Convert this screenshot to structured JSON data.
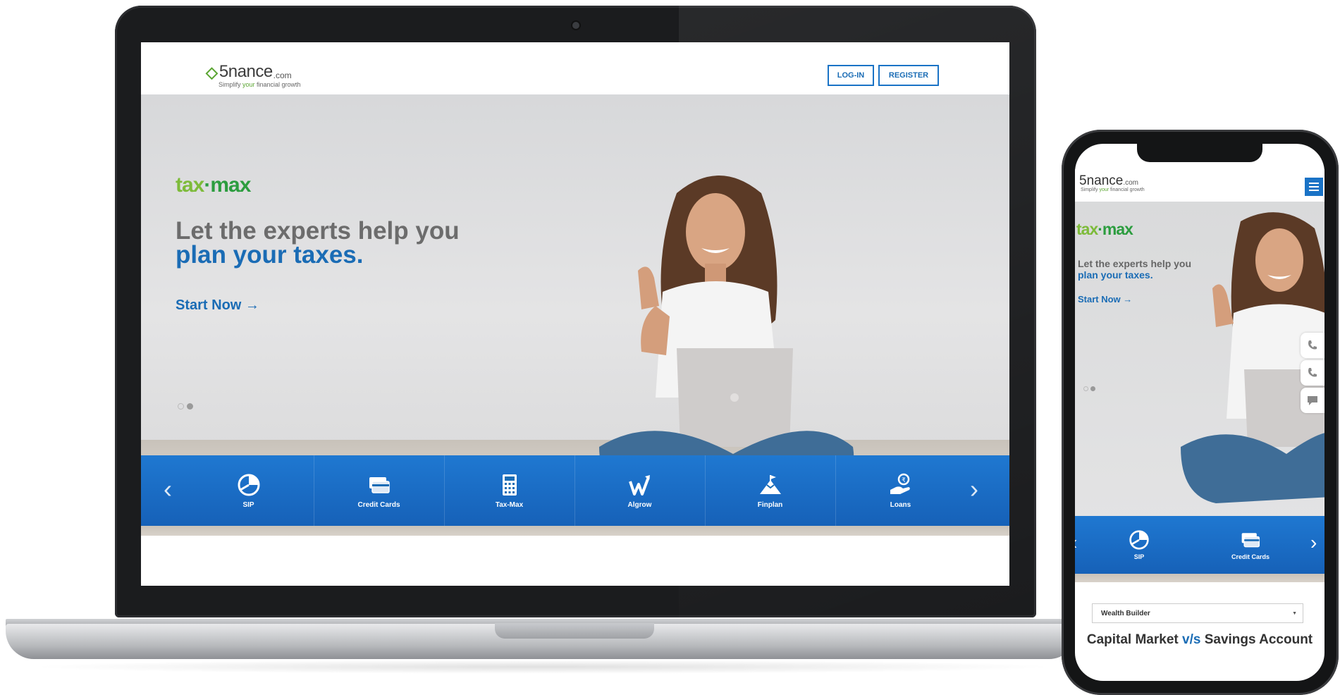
{
  "site": {
    "logo": {
      "mark": "◇",
      "name": "5nance",
      "domain": ".com"
    },
    "tagline_parts": [
      "Simplify ",
      "your",
      " financial growth"
    ]
  },
  "header": {
    "login_label": "LOG-IN",
    "register_label": "REGISTER"
  },
  "hero": {
    "brand_a": "tax",
    "brand_b": "max",
    "headline_line1": "Let the experts help you",
    "headline_line2": "plan your taxes.",
    "cta_label": "Start Now →",
    "slide_count": 2,
    "active_slide": 2
  },
  "products": [
    {
      "label": "SIP",
      "icon": "pie-chart-icon"
    },
    {
      "label": "Credit Cards",
      "icon": "credit-card-icon"
    },
    {
      "label": "Tax-Max",
      "icon": "calculator-icon"
    },
    {
      "label": "Algrow",
      "icon": "growth-arrow-icon"
    },
    {
      "label": "Finplan",
      "icon": "mountain-flag-icon"
    },
    {
      "label": "Loans",
      "icon": "hand-coin-icon"
    }
  ],
  "nav_arrows": {
    "prev": "‹",
    "next": "›"
  },
  "mobile": {
    "logo": {
      "name": "5nance",
      "domain": ".com"
    },
    "tagline_parts": [
      "Simplify ",
      "your",
      " financial growth"
    ],
    "hero": {
      "brand_a": "tax",
      "brand_b": "max",
      "headline_line1": "Let the experts help you",
      "headline_line2": "plan your taxes.",
      "cta_label": "Start Now →"
    },
    "products": [
      {
        "label": "SIP",
        "icon": "pie-chart-icon"
      },
      {
        "label": "Credit Cards",
        "icon": "credit-card-icon"
      }
    ],
    "select": {
      "value": "Wealth Builder",
      "caret": "▼"
    },
    "article_title_a": "Capital Market ",
    "article_title_vs": "v/s",
    "article_title_b": " Savings Account",
    "float_icons": [
      "phone-icon",
      "phone-icon",
      "chat-icon"
    ]
  },
  "colors": {
    "brand_blue": "#1a6cb5",
    "bar_blue": "#1f78d1",
    "brand_green": "#7dbb3a",
    "dark_green": "#2c9d3f"
  }
}
